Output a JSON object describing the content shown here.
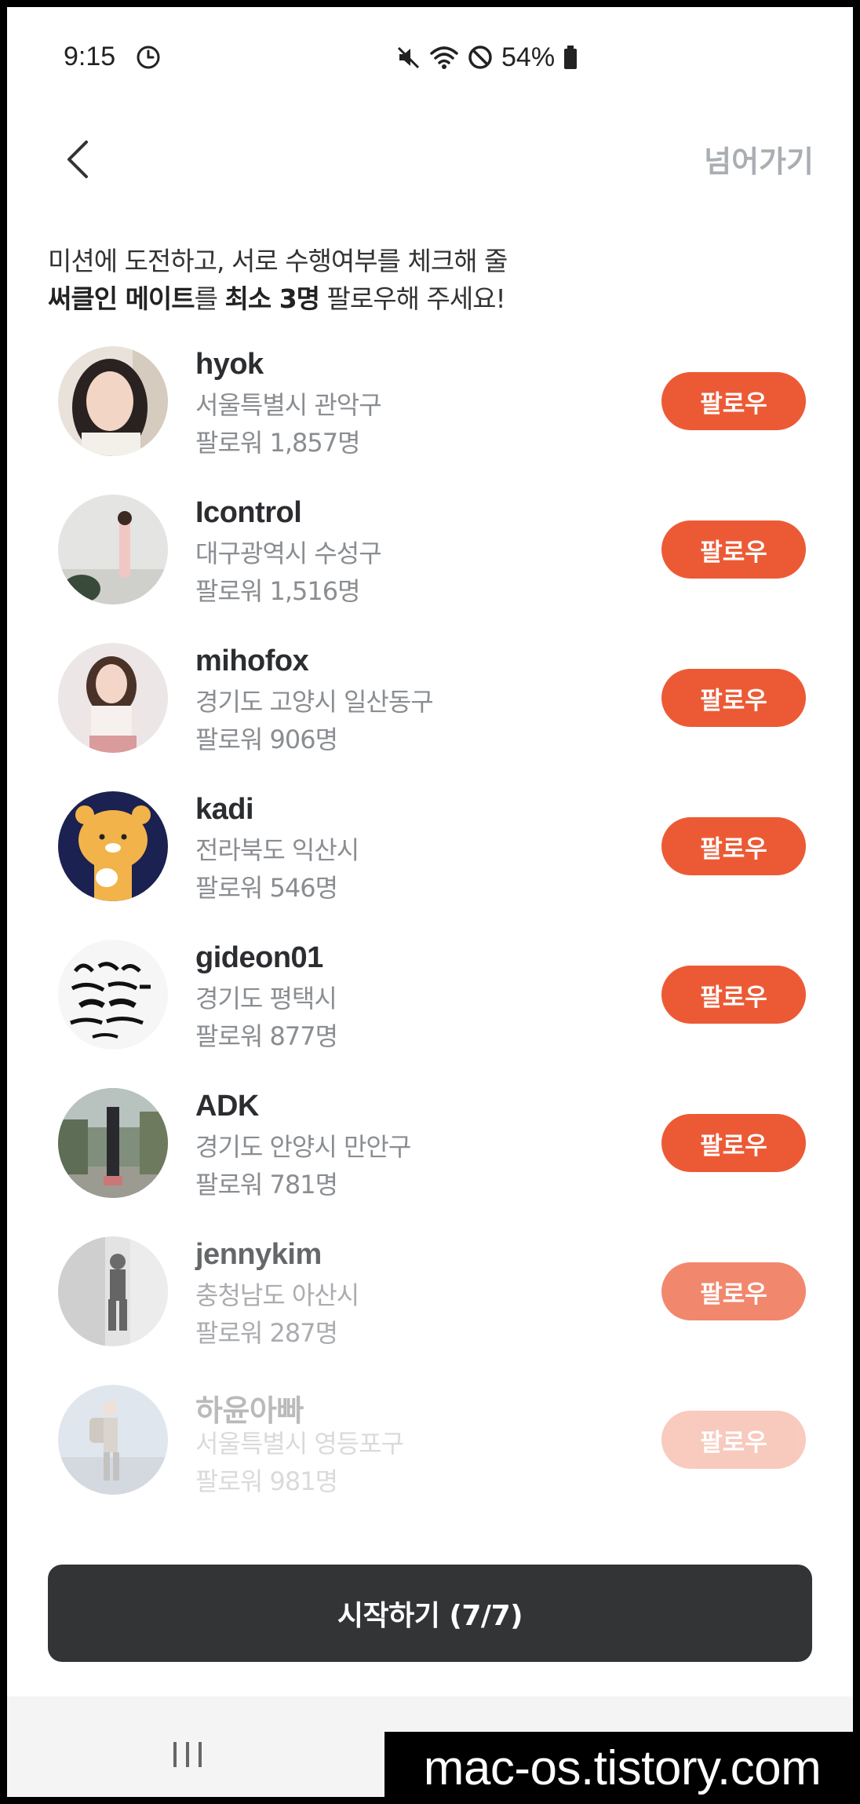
{
  "status_bar": {
    "time": "9:15",
    "battery": "54%"
  },
  "header": {
    "skip_label": "넘어가기"
  },
  "instruction": {
    "line1": "미션에 도전하고, 서로 수행여부를 체크해 줄",
    "line2_bold1": "써클인 메이트",
    "line2_text1": "를 ",
    "line2_bold2": "최소 3명",
    "line2_text2": " 팔로우해 주세요!"
  },
  "mates": [
    {
      "name": "hyok",
      "region": "서울특별시 관악구",
      "followers": "팔로워 1,857명",
      "follow_label": "팔로우"
    },
    {
      "name": "Icontrol",
      "region": "대구광역시 수성구",
      "followers": "팔로워 1,516명",
      "follow_label": "팔로우"
    },
    {
      "name": "mihofox",
      "region": "경기도 고양시 일산동구",
      "followers": "팔로워 906명",
      "follow_label": "팔로우"
    },
    {
      "name": "kadi",
      "region": "전라북도 익산시",
      "followers": "팔로워 546명",
      "follow_label": "팔로우"
    },
    {
      "name": "gideon01",
      "region": "경기도 평택시",
      "followers": "팔로워 877명",
      "follow_label": "팔로우"
    },
    {
      "name": "ADK",
      "region": "경기도 안양시 만안구",
      "followers": "팔로워 781명",
      "follow_label": "팔로우"
    },
    {
      "name": "jennykim",
      "region": "충청남도 아산시",
      "followers": "팔로워 287명",
      "follow_label": "팔로우"
    },
    {
      "name": "하윤아빠",
      "region": "서울특별시 영등포구",
      "followers": "팔로워 981명",
      "follow_label": "팔로우"
    }
  ],
  "start_button": {
    "label": "시작하기 (7/7)"
  },
  "watermark": "mac-os.tistory.com",
  "colors": {
    "accent": "#ec5a35",
    "start_button": "#333436",
    "skip_text": "#a9aeb3"
  },
  "icons": {
    "back": "chevron-left-icon",
    "clock": "clock-icon",
    "mute": "mute-icon",
    "wifi": "wifi-icon",
    "dnd": "do-not-disturb-icon",
    "battery": "battery-icon"
  }
}
